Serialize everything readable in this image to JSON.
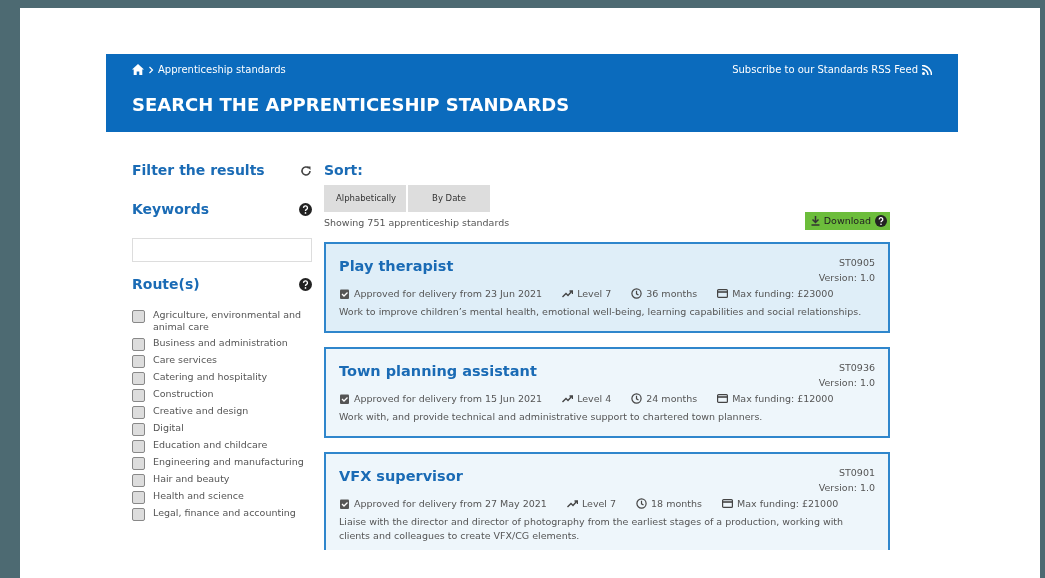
{
  "breadcrumb": {
    "items": [
      "Apprenticeship standards"
    ]
  },
  "rss_link": "Subscribe to our Standards RSS Feed",
  "page_title": "SEARCH THE APPRENTICESHIP STANDARDS",
  "filter": {
    "title": "Filter the results",
    "keywords_label": "Keywords",
    "routes_label": "Route(s)",
    "routes": [
      {
        "label": "Agriculture, environmental and animal care",
        "checked": false
      },
      {
        "label": "Business and administration",
        "checked": false
      },
      {
        "label": "Care services",
        "checked": false
      },
      {
        "label": "Catering and hospitality",
        "checked": false
      },
      {
        "label": "Construction",
        "checked": false
      },
      {
        "label": "Creative and design",
        "checked": false
      },
      {
        "label": "Digital",
        "checked": false
      },
      {
        "label": "Education and childcare",
        "checked": false
      },
      {
        "label": "Engineering and manufacturing",
        "checked": false
      },
      {
        "label": "Hair and beauty",
        "checked": false
      },
      {
        "label": "Health and science",
        "checked": false
      },
      {
        "label": "Legal, finance and accounting",
        "checked": false
      }
    ]
  },
  "sort": {
    "label": "Sort:",
    "options": [
      {
        "label": "Alphabetically",
        "selected": false
      },
      {
        "label": "By Date",
        "selected": false
      }
    ]
  },
  "result_count": "Showing 751 apprenticeship standards",
  "download_button": "Download",
  "results": [
    {
      "title": "Play therapist",
      "code": "ST0905",
      "version": "Version: 1.0",
      "highlighted": true,
      "approved": "Approved for delivery from 23 Jun 2021",
      "level": "Level 7",
      "duration": "36 months",
      "funding": "Max funding: £23000",
      "description": "Work to improve children’s mental health, emotional well-being, learning capabilities and social relationships."
    },
    {
      "title": "Town planning assistant",
      "code": "ST0936",
      "version": "Version: 1.0",
      "highlighted": false,
      "approved": "Approved for delivery from 15 Jun 2021",
      "level": "Level 4",
      "duration": "24 months",
      "funding": "Max funding: £12000",
      "description": "Work with, and provide technical and administrative support to chartered town planners."
    },
    {
      "title": "VFX supervisor",
      "code": "ST0901",
      "version": "Version: 1.0",
      "highlighted": false,
      "approved": "Approved for delivery from 27 May 2021",
      "level": "Level 7",
      "duration": "18 months",
      "funding": "Max funding: £21000",
      "description": "Liaise with the director and director of photography from the earliest stages of a production, working with clients and colleagues to create VFX/CG elements."
    }
  ]
}
